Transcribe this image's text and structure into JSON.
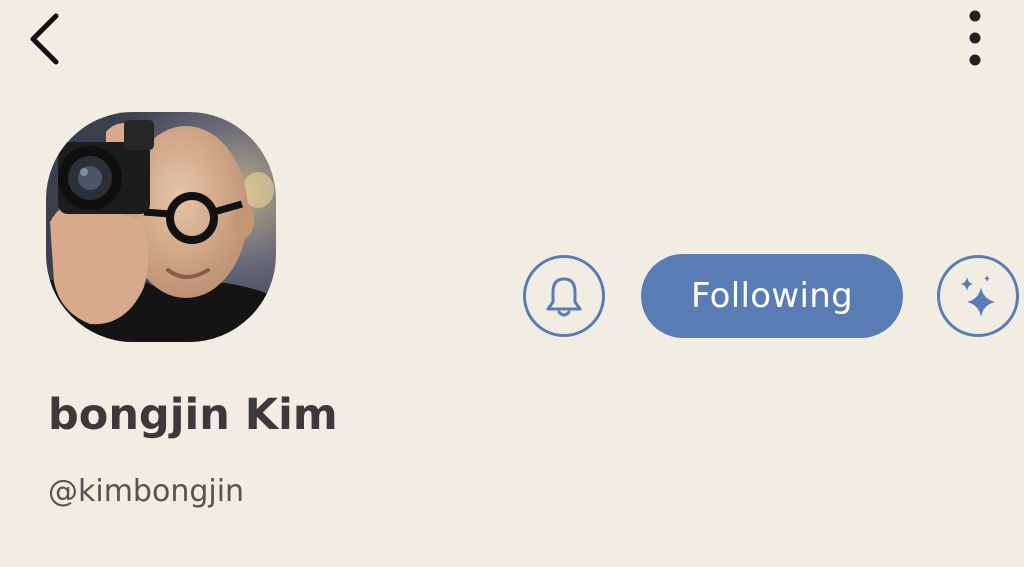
{
  "header": {
    "back_icon": "chevron-left-icon",
    "more_icon": "vertical-ellipsis-icon"
  },
  "profile": {
    "display_name": "bongjin Kim",
    "handle": "@kimbongjin",
    "avatar": "profile-photo"
  },
  "actions": {
    "notification_icon": "bell-icon",
    "follow_label": "Following",
    "sparkle_icon": "sparkle-icon"
  },
  "colors": {
    "background": "#f2ede3",
    "accent": "#5a7cb5",
    "name_text": "#3a3a3a",
    "handle_text": "#545454"
  }
}
